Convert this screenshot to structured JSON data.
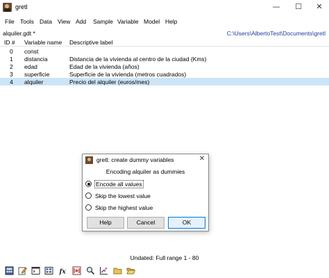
{
  "window": {
    "title": "gretl",
    "controls": {
      "minimize": "—",
      "maximize": "☐",
      "close": "✕"
    }
  },
  "menu": [
    "File",
    "Tools",
    "Data",
    "View",
    "Add",
    "Sample",
    "Variable",
    "Model",
    "Help"
  ],
  "dataset": {
    "file": "alquiler.gdt *",
    "path": "C:\\Users\\AlbertoTest\\Documents\\gretl"
  },
  "table": {
    "headers": {
      "id": "ID #",
      "name": "Variable name",
      "label": "Descriptive label"
    },
    "rows": [
      {
        "id": "0",
        "name": "const",
        "label": ""
      },
      {
        "id": "1",
        "name": "distancia",
        "label": "Distancia de la vivienda al centro de la ciudad (Kms)"
      },
      {
        "id": "2",
        "name": "edad",
        "label": "Edad de la vivienda (años)"
      },
      {
        "id": "3",
        "name": "superficie",
        "label": "Superficie de la vivienda (metros cuadrados)"
      },
      {
        "id": "4",
        "name": "alquiler",
        "label": "Precio del alquiler (euros/mes)"
      }
    ],
    "selected_row": "4"
  },
  "dialog": {
    "title": "gretl: create dummy variables",
    "close": "✕",
    "message": "Encoding alquiler as dummies",
    "options": [
      "Encode all values",
      "Skip the lowest value",
      "Skip the highest value"
    ],
    "selected_option": "Encode all values",
    "buttons": {
      "help": "Help",
      "cancel": "Cancel",
      "ok": "OK"
    }
  },
  "status": "Undated: Full range 1 - 80",
  "toolbar_icons": [
    "calculator-icon",
    "edit-icon",
    "terminal-icon",
    "session-icon",
    "function-icon",
    "matrix-icon",
    "search-icon",
    "scatter-plot-icon",
    "folder-icon",
    "open-folder-icon"
  ]
}
